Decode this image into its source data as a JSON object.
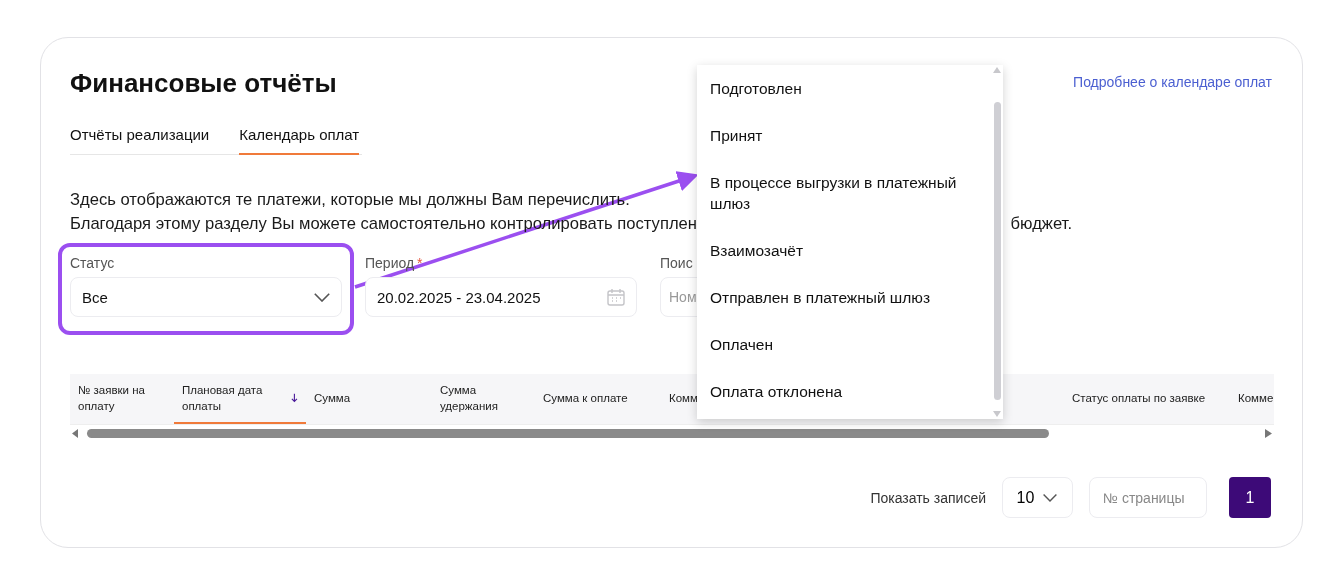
{
  "header": {
    "title": "Финансовые отчёты",
    "link": "Подробнее о календаре оплат"
  },
  "tabs": [
    {
      "label": "Отчёты реализации",
      "selected": false
    },
    {
      "label": "Календарь оплат",
      "selected": true
    }
  ],
  "description": {
    "line_1": "Здесь отображаются те платежи, которые мы должны Вам перечислить.",
    "line_2_start": "Благодаря этому разделу Вы можете самостоятельно контролировать поступлен",
    "line_2_end": "бюджет."
  },
  "filters": [
    {
      "kind": "select",
      "label": "Статус",
      "value": "Все",
      "highlighted": true
    },
    {
      "kind": "date",
      "label": "Период",
      "required_mark": "*",
      "value": "20.02.2025 - 23.04.2025",
      "highlighted": false
    },
    {
      "kind": "search",
      "label": "Поис",
      "placeholder": "Ном",
      "highlighted": false
    }
  ],
  "dropdown": {
    "options": [
      "Подготовлен",
      "Принят",
      "В процессе выгрузки в платежный шлюз",
      "Взаимозачёт",
      "Отправлен в платежный шлюз",
      "Оплачен",
      "Оплата отклонена"
    ]
  },
  "table": {
    "columns": [
      {
        "label": "№ заявки на оплату",
        "sorted": false
      },
      {
        "label": "Плановая дата оплаты",
        "sorted": true
      },
      {
        "label": "Сумма",
        "sorted": false
      },
      {
        "label": "Сумма удержания",
        "sorted": false
      },
      {
        "label": "Сумма к оплате",
        "sorted": false
      },
      {
        "label": "Комм",
        "sorted": false
      },
      {
        "label": "Статус оплаты по заявке",
        "sorted": false
      },
      {
        "label": "Комме",
        "sorted": false
      }
    ]
  },
  "pagination": {
    "label": "Показать записей",
    "page_size": "10",
    "page_input_placeholder": "№ страницы",
    "pages": [
      {
        "label": "1",
        "selected": true
      }
    ]
  }
}
